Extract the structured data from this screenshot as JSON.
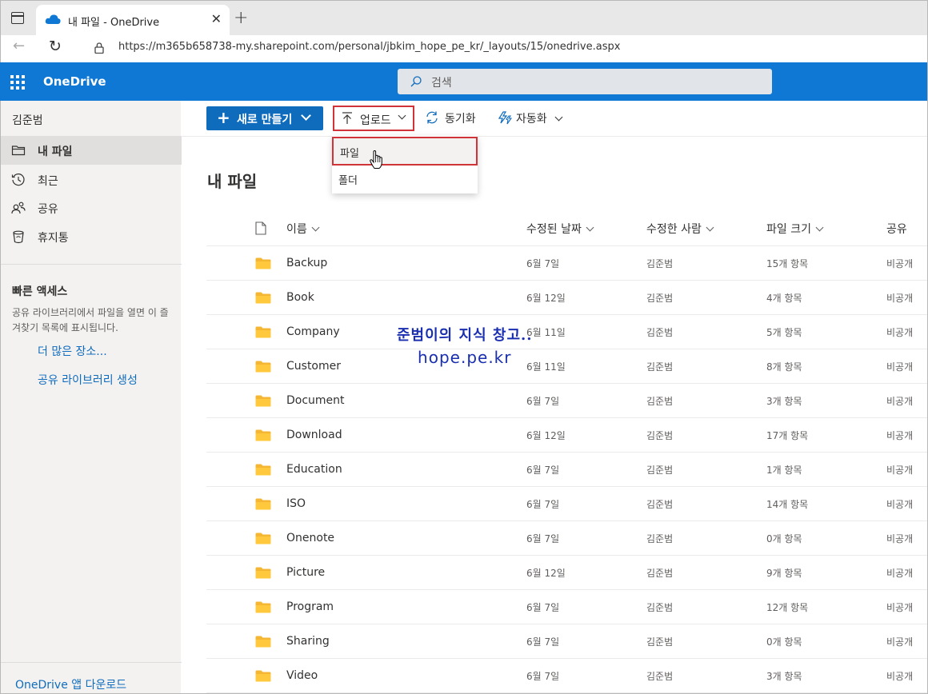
{
  "browser": {
    "tab_title": "내 파일 - OneDrive",
    "url": "https://m365b658738-my.sharepoint.com/personal/jbkim_hope_pe_kr/_layouts/15/onedrive.aspx"
  },
  "suite": {
    "brand": "OneDrive",
    "search_placeholder": "검색",
    "accent": "#0f78d4"
  },
  "leftnav": {
    "user": "김준범",
    "items": [
      {
        "label": "내 파일",
        "icon": "folder-icon",
        "selected": true
      },
      {
        "label": "최근",
        "icon": "clock-icon",
        "selected": false
      },
      {
        "label": "공유",
        "icon": "people-icon",
        "selected": false
      },
      {
        "label": "휴지통",
        "icon": "recycle-bin-icon",
        "selected": false
      }
    ],
    "quick_title": "빠른 액세스",
    "quick_desc": "공유 라이브러리에서 파일을 열면 이 즐겨찾기 목록에 표시됩니다.",
    "more_places": "더 많은 장소...",
    "create_library": "공유 라이브러리 생성",
    "app_download": "OneDrive 앱 다운로드"
  },
  "commandbar": {
    "new_label": "새로 만들기",
    "upload_label": "업로드",
    "sync_label": "동기화",
    "automate_label": "자동화"
  },
  "upload_menu": {
    "items": [
      "파일",
      "폴더"
    ]
  },
  "main": {
    "title": "내 파일",
    "columns": {
      "name": "이름",
      "modified": "수정된 날짜",
      "modified_by": "수정한 사람",
      "size": "파일 크기",
      "sharing": "공유"
    },
    "rows": [
      {
        "name": "Backup",
        "modified": "6월 7일",
        "by": "김준범",
        "size": "15개 항목",
        "sharing": "비공개"
      },
      {
        "name": "Book",
        "modified": "6월 12일",
        "by": "김준범",
        "size": "4개 항목",
        "sharing": "비공개"
      },
      {
        "name": "Company",
        "modified": "6월 11일",
        "by": "김준범",
        "size": "5개 항목",
        "sharing": "비공개"
      },
      {
        "name": "Customer",
        "modified": "6월 11일",
        "by": "김준범",
        "size": "8개 항목",
        "sharing": "비공개"
      },
      {
        "name": "Document",
        "modified": "6월 7일",
        "by": "김준범",
        "size": "3개 항목",
        "sharing": "비공개"
      },
      {
        "name": "Download",
        "modified": "6월 12일",
        "by": "김준범",
        "size": "17개 항목",
        "sharing": "비공개"
      },
      {
        "name": "Education",
        "modified": "6월 7일",
        "by": "김준범",
        "size": "1개 항목",
        "sharing": "비공개"
      },
      {
        "name": "ISO",
        "modified": "6월 7일",
        "by": "김준범",
        "size": "14개 항목",
        "sharing": "비공개"
      },
      {
        "name": "Onenote",
        "modified": "6월 7일",
        "by": "김준범",
        "size": "0개 항목",
        "sharing": "비공개"
      },
      {
        "name": "Picture",
        "modified": "6월 12일",
        "by": "김준범",
        "size": "9개 항목",
        "sharing": "비공개"
      },
      {
        "name": "Program",
        "modified": "6월 7일",
        "by": "김준범",
        "size": "12개 항목",
        "sharing": "비공개"
      },
      {
        "name": "Sharing",
        "modified": "6월 7일",
        "by": "김준범",
        "size": "0개 항목",
        "sharing": "비공개"
      },
      {
        "name": "Video",
        "modified": "6월 7일",
        "by": "김준범",
        "size": "3개 항목",
        "sharing": "비공개"
      }
    ]
  },
  "watermark": {
    "line1": "준범이의 지식 창고..",
    "line2": "hope.pe.kr"
  }
}
